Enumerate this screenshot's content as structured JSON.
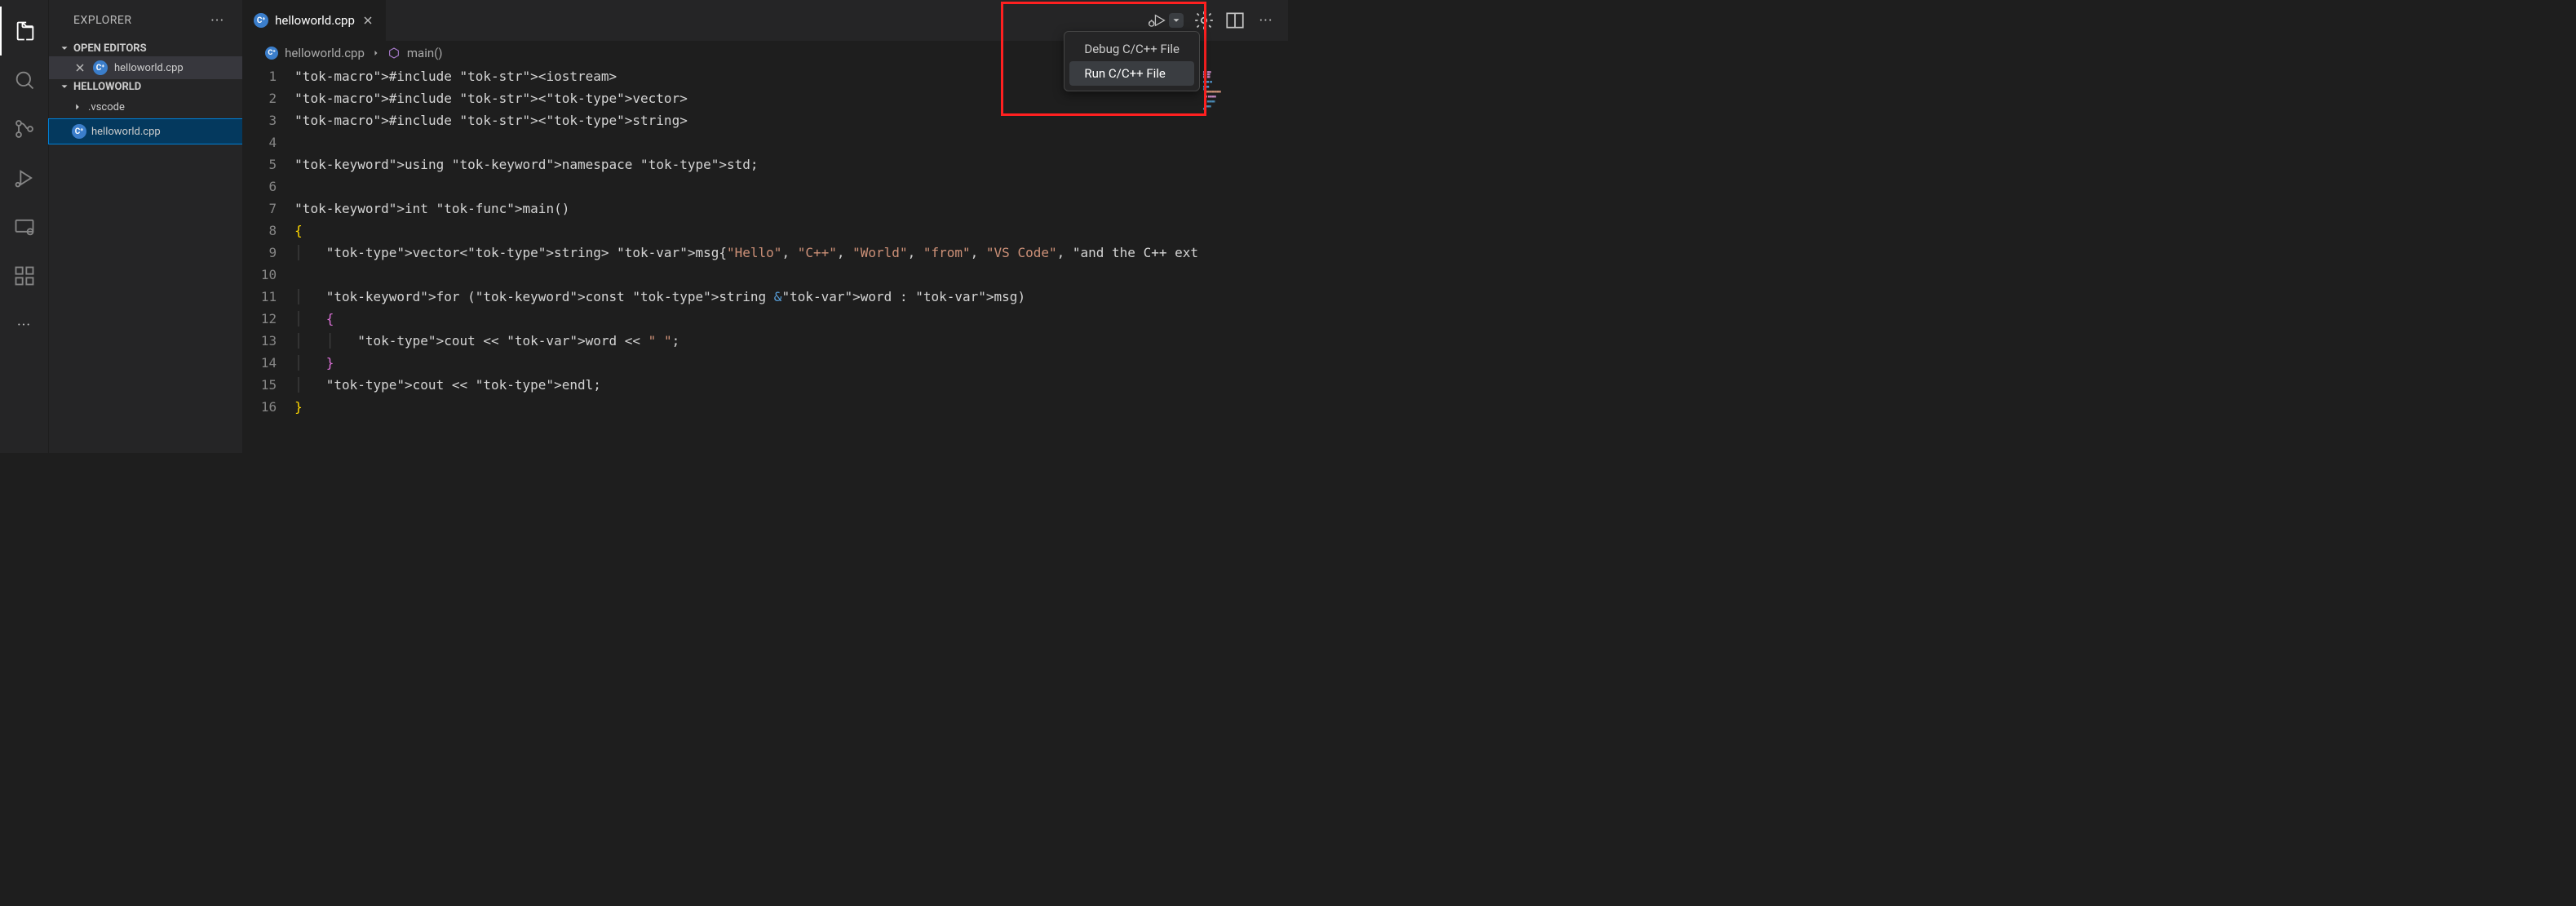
{
  "sidebar": {
    "title": "EXPLORER",
    "open_editors_label": "OPEN EDITORS",
    "workspace_label": "HELLOWORLD",
    "open_editor_items": [
      {
        "name": "helloworld.cpp"
      }
    ],
    "tree": [
      {
        "name": ".vscode",
        "kind": "folder"
      },
      {
        "name": "helloworld.cpp",
        "kind": "cpp",
        "selected": true
      }
    ]
  },
  "tabs": {
    "active": "helloworld.cpp"
  },
  "run_menu": {
    "debug": "Debug C/C++ File",
    "run": "Run C/C++ File"
  },
  "breadcrumbs": {
    "file": "helloworld.cpp",
    "symbol": "main()"
  },
  "code_lines": [
    "#include <iostream>",
    "#include <vector>",
    "#include <string>",
    "",
    "using namespace std;",
    "",
    "int main()",
    "{",
    "    vector<string> msg{\"Hello\", \"C++\", \"World\", \"from\", \"VS Code\", \"and the C++ ext",
    "",
    "    for (const string &word : msg)",
    "    {",
    "        cout << word << \" \";",
    "    }",
    "    cout << endl;",
    "}"
  ],
  "line_numbers": [
    "1",
    "2",
    "3",
    "4",
    "5",
    "6",
    "7",
    "8",
    "9",
    "10",
    "11",
    "12",
    "13",
    "14",
    "15",
    "16"
  ]
}
